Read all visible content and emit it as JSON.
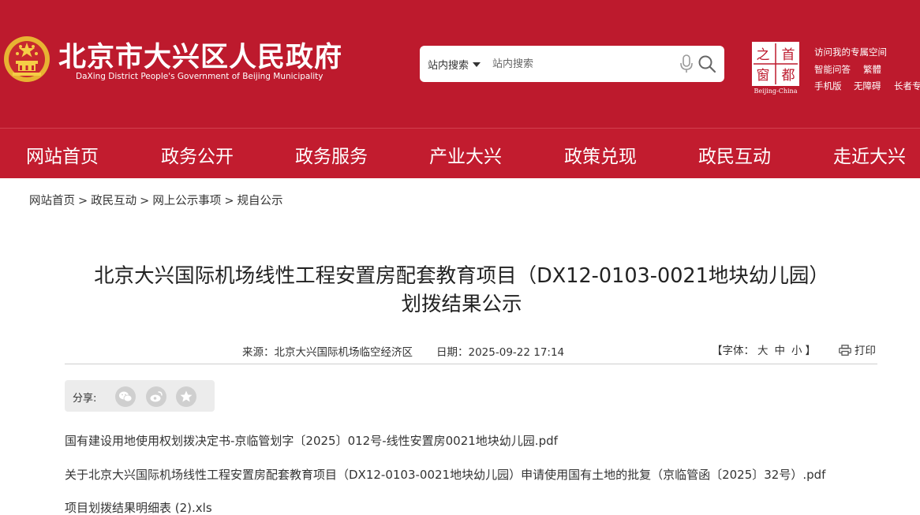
{
  "header": {
    "title": "北京市大兴区人民政府",
    "subtitle": "DaXing District People's Government of Beijing Municipality",
    "emblem_icon": "national-emblem-icon",
    "brand_color": "#bd1a2d"
  },
  "search": {
    "scope_label": "站内搜索",
    "placeholder": "站内搜索"
  },
  "capital_logo": {
    "chars": [
      "之",
      "首",
      "窗",
      "都"
    ],
    "caption": "Beijing-China"
  },
  "quick_links": {
    "special_space": "访问我的专属空间",
    "smart_qa": "智能问答",
    "traditional": "繁體",
    "mobile": "手机版",
    "accessibility": "无障碍",
    "elderly": "长者专"
  },
  "nav": {
    "items": [
      "网站首页",
      "政务公开",
      "政务服务",
      "产业大兴",
      "政策兑现",
      "政民互动",
      "走近大兴"
    ]
  },
  "breadcrumb": {
    "items": [
      "网站首页",
      "政民互动",
      "网上公示事项",
      "规自公示"
    ],
    "separator": ">"
  },
  "article": {
    "title_line1": "北京大兴国际机场线性工程安置房配套教育项目（DX12-0103-0021地块幼儿园）",
    "title_line2": "划拨结果公示",
    "source": "来源：北京大兴国际机场临空经济区",
    "date": "日期：2025-09-22 17:14",
    "font_label_open": "【字体：",
    "font_large": "大",
    "font_medium": "中",
    "font_small": "小",
    "font_label_close": "】",
    "print_label": "打印"
  },
  "share": {
    "label": "分享:",
    "icons": [
      "wechat-icon",
      "weibo-icon",
      "favorite-icon"
    ]
  },
  "attachments": [
    "国有建设用地使用权划拨决定书-京临管划字〔2025〕012号-线性安置房0021地块幼儿园.pdf",
    "关于北京大兴国际机场线性工程安置房配套教育项目（DX12-0103-0021地块幼儿园）申请使用国有土地的批复（京临管函〔2025〕32号）.pdf",
    "项目划拨结果明细表 (2).xls"
  ]
}
